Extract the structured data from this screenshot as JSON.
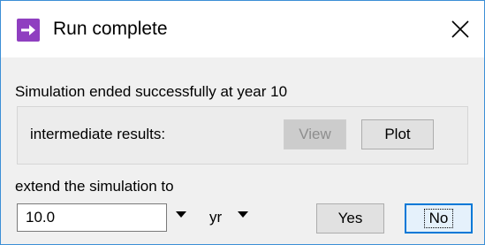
{
  "window": {
    "title": "Run complete",
    "app_icon": "right-arrow-icon",
    "icon_color": "#8f3fc0",
    "close_icon": "close-icon"
  },
  "message": "Simulation ended successfully at  year 10",
  "intermediate": {
    "label": "intermediate results:",
    "view_label": "View",
    "view_enabled": false,
    "plot_label": "Plot"
  },
  "extend": {
    "label": "extend the simulation to",
    "value": "10.0",
    "unit": "yr"
  },
  "actions": {
    "yes_label": "Yes",
    "no_label": "No",
    "default": "No"
  },
  "colors": {
    "accent": "#0078d7",
    "window_border": "#3c8fd6",
    "background": "#f0f0f0"
  }
}
